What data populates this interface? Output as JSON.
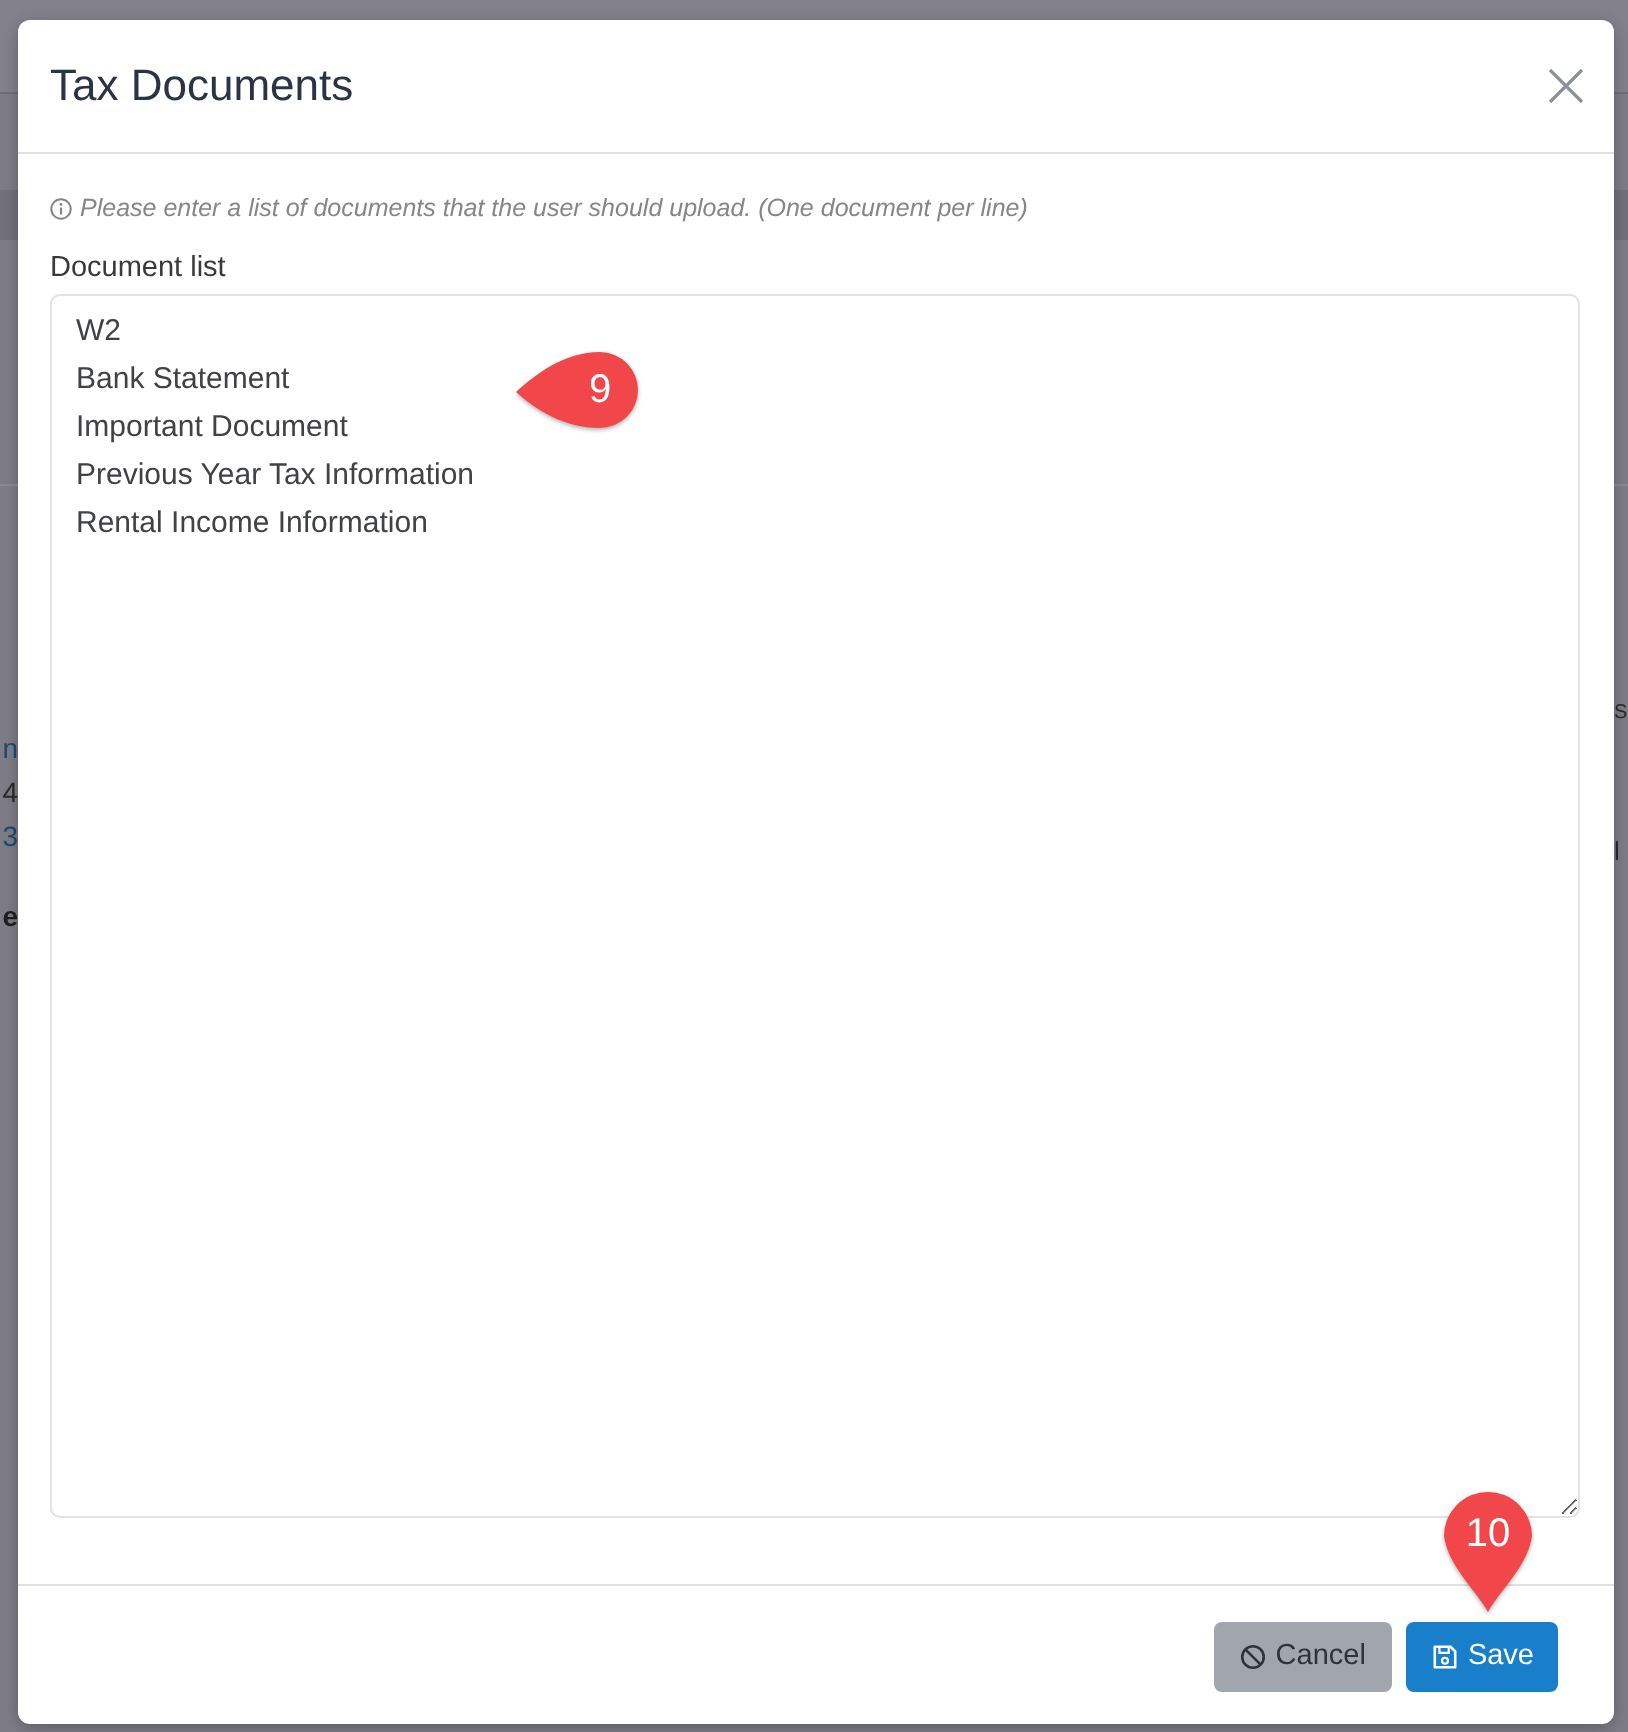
{
  "background": {
    "left_fragments": [
      {
        "text": "n",
        "kind": "link"
      },
      {
        "text": "4",
        "kind": "text"
      },
      {
        "text": "3",
        "kind": "link"
      },
      {
        "text": "e",
        "kind": "bold"
      }
    ],
    "right_fragments": [
      "S",
      "l"
    ]
  },
  "modal": {
    "title": "Tax Documents",
    "hint": "Please enter a list of documents that the user should upload. (One document per line)",
    "field_label": "Document list",
    "document_list": {
      "lines": [
        "W2",
        "Bank Statement",
        "Important Document",
        "Previous Year Tax Information",
        "Rental Income Information"
      ]
    },
    "buttons": [
      {
        "kind": "cancel",
        "label": "Cancel"
      },
      {
        "kind": "save",
        "label": "Save"
      }
    ]
  },
  "callouts": [
    {
      "kind": "left",
      "label": "9"
    },
    {
      "kind": "down",
      "label": "10"
    }
  ]
}
